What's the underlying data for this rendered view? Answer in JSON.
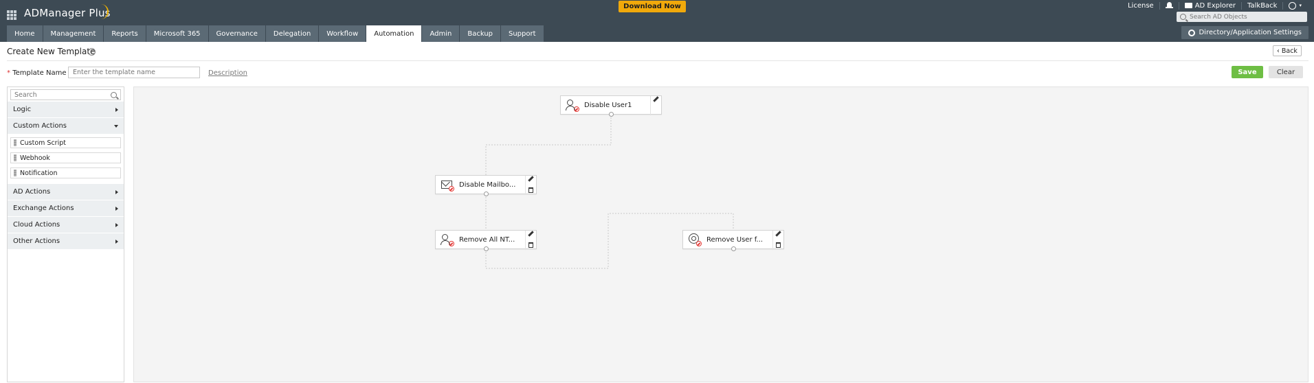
{
  "header": {
    "app_name": "ADManager Plus",
    "download_label": "Download Now",
    "links": {
      "license": "License",
      "ad_explorer": "AD Explorer",
      "talkback": "TalkBack"
    },
    "search_placeholder": "Search AD Objects",
    "settings_label": "Directory/Application Settings"
  },
  "tabs": [
    "Home",
    "Management",
    "Reports",
    "Microsoft 365",
    "Governance",
    "Delegation",
    "Workflow",
    "Automation",
    "Admin",
    "Backup",
    "Support"
  ],
  "active_tab": "Automation",
  "page": {
    "title": "Create New Template",
    "back_label": "Back",
    "template_name_label": "Template Name",
    "required_mark": "*",
    "template_name_placeholder": "Enter the template name",
    "description_link": "Description",
    "save_label": "Save",
    "clear_label": "Clear"
  },
  "palette": {
    "search_placeholder": "Search",
    "categories": [
      {
        "label": "Logic",
        "expanded": false
      },
      {
        "label": "Custom Actions",
        "expanded": true,
        "items": [
          "Custom Script",
          "Webhook",
          "Notification"
        ]
      },
      {
        "label": "AD Actions",
        "expanded": false
      },
      {
        "label": "Exchange Actions",
        "expanded": false
      },
      {
        "label": "Cloud Actions",
        "expanded": false
      },
      {
        "label": "Other Actions",
        "expanded": false
      }
    ]
  },
  "workflow": {
    "nodes": [
      {
        "label": "Disable User1",
        "icon": "user-disable-icon"
      },
      {
        "label": "Disable Mailbo...",
        "icon": "mailbox-disable-icon"
      },
      {
        "label": "Remove All NT...",
        "icon": "user-remove-icon"
      },
      {
        "label": "Remove User f...",
        "icon": "group-remove-icon"
      }
    ]
  },
  "colors": {
    "header_bg": "#3d4a54",
    "download": "#f1a90b",
    "save": "#6ebe44",
    "canvas_bg": "#f4f4f4"
  }
}
